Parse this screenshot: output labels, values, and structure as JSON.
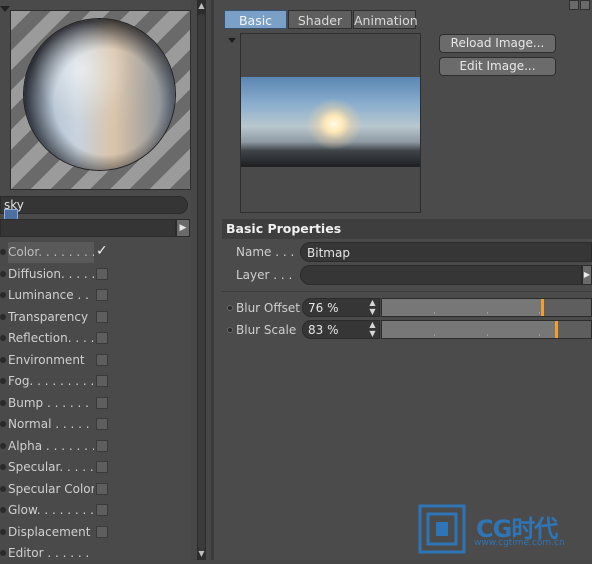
{
  "material_name": "sky",
  "channels": [
    {
      "label": "Color. . . . . . . .",
      "checked": true,
      "active": true
    },
    {
      "label": "Diffusion. . . . . .",
      "checked": false
    },
    {
      "label": "Luminance . . . .",
      "checked": false
    },
    {
      "label": "Transparency",
      "checked": false
    },
    {
      "label": "Reflection. . . .",
      "checked": false
    },
    {
      "label": "Environment",
      "checked": false
    },
    {
      "label": "Fog. . . . . . . . .",
      "checked": false
    },
    {
      "label": "Bump . . . . . . .",
      "checked": false
    },
    {
      "label": "Normal . . . . . .",
      "checked": false
    },
    {
      "label": "Alpha . . . . . . .",
      "checked": false
    },
    {
      "label": "Specular. . . . . .",
      "checked": false
    },
    {
      "label": "Specular Color",
      "checked": false
    },
    {
      "label": "Glow. . . . . . . .",
      "checked": false
    },
    {
      "label": "Displacement",
      "checked": false
    },
    {
      "label": "Editor . . . . . . .",
      "checked": null
    }
  ],
  "check_glyph": "✓",
  "tabs": [
    {
      "label": "Basic",
      "active": true
    },
    {
      "label": "Shader",
      "active": false
    },
    {
      "label": "Animation",
      "active": false
    }
  ],
  "buttons": {
    "reload": "Reload Image...",
    "edit": "Edit Image..."
  },
  "section_title": "Basic Properties",
  "props": {
    "name_label": "Name . . .",
    "name_value": "Bitmap",
    "layer_label": "Layer . . .",
    "blur_offset_label": "Blur Offset",
    "blur_offset_value": "76 %",
    "blur_offset_fraction": 0.76,
    "blur_scale_label": "Blur Scale",
    "blur_scale_value": "83 %",
    "blur_scale_fraction": 0.83
  },
  "watermark": {
    "brand": "CG时代",
    "url": "www.cgtime.com.cn"
  },
  "colors": {
    "active_tab": "#7aa0c8",
    "slider_knob": "#f0a030",
    "brand_blue": "#2f74b5"
  }
}
